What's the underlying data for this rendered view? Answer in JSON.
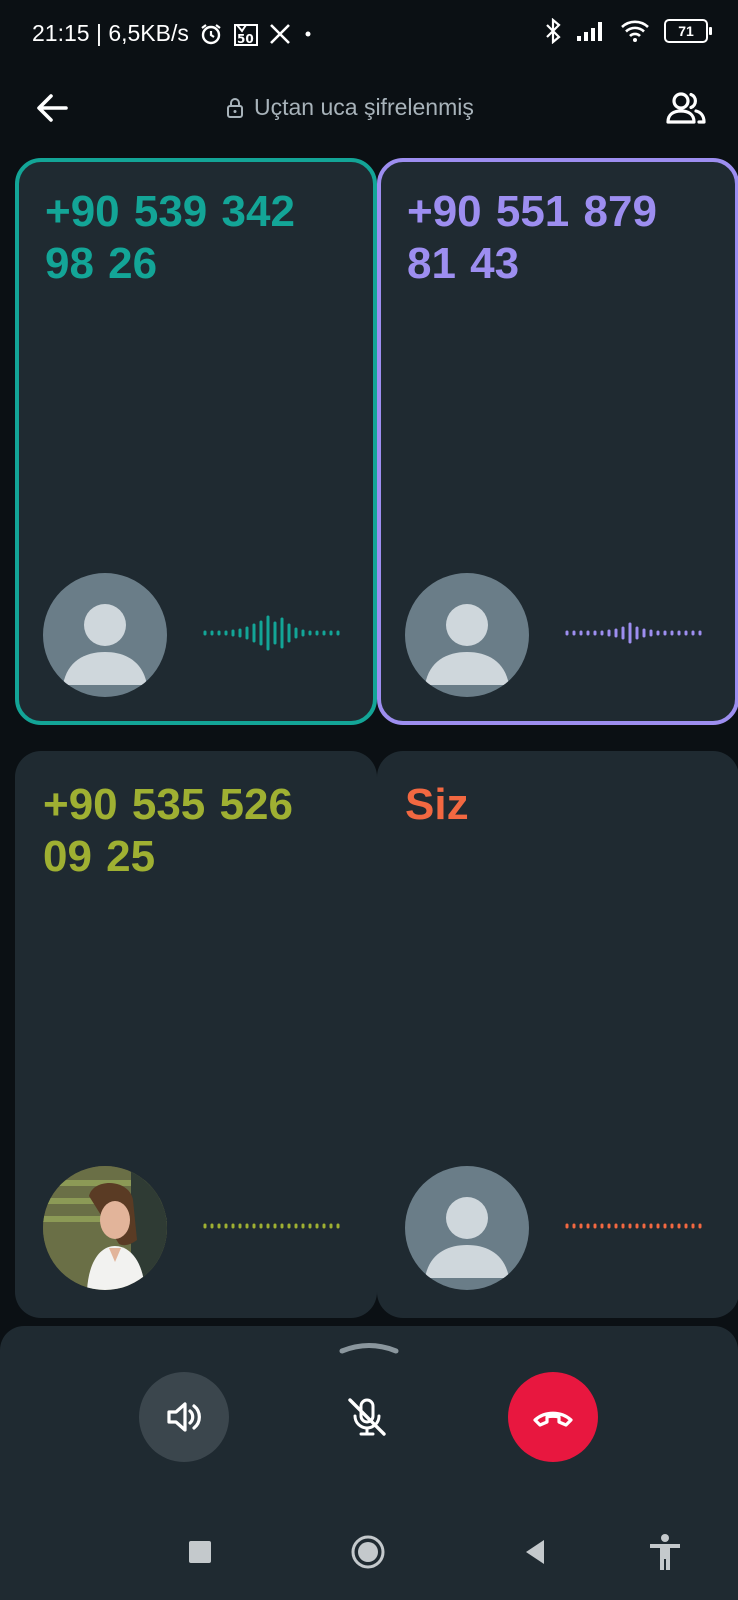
{
  "status_bar": {
    "time": "21:15",
    "speed": "6,5KB/s",
    "battery": "71",
    "icons": [
      "alarm-icon",
      "notification-50-icon",
      "x-icon",
      "dot-icon",
      "bluetooth-icon",
      "signal-icon",
      "wifi-icon",
      "battery-icon"
    ]
  },
  "header": {
    "encryption_label": "Uçtan uca şifrelenmiş",
    "back_icon": "arrow-left-icon",
    "participants_icon": "people-icon"
  },
  "participants": [
    {
      "name": "+90 539 342 98 26",
      "color": "#13a597",
      "active_speaker": true,
      "avatar": "default-avatar"
    },
    {
      "name": "+90 551 879 81 43",
      "color": "#9d8ef0",
      "active_speaker": true,
      "avatar": "default-avatar"
    },
    {
      "name": "+90 535 526 09 25",
      "color": "#9fb032",
      "active_speaker": false,
      "avatar": "photo-avatar"
    },
    {
      "name": "Siz",
      "color": "#f26841",
      "active_speaker": false,
      "avatar": "default-avatar"
    }
  ],
  "controls": {
    "speaker_icon": "speaker-icon",
    "mic_icon": "mic-off-icon",
    "end_call_icon": "end-call-icon",
    "end_call_color": "#e8173f"
  },
  "nav": [
    "recents-icon",
    "home-icon",
    "back-icon",
    "accessibility-icon"
  ]
}
